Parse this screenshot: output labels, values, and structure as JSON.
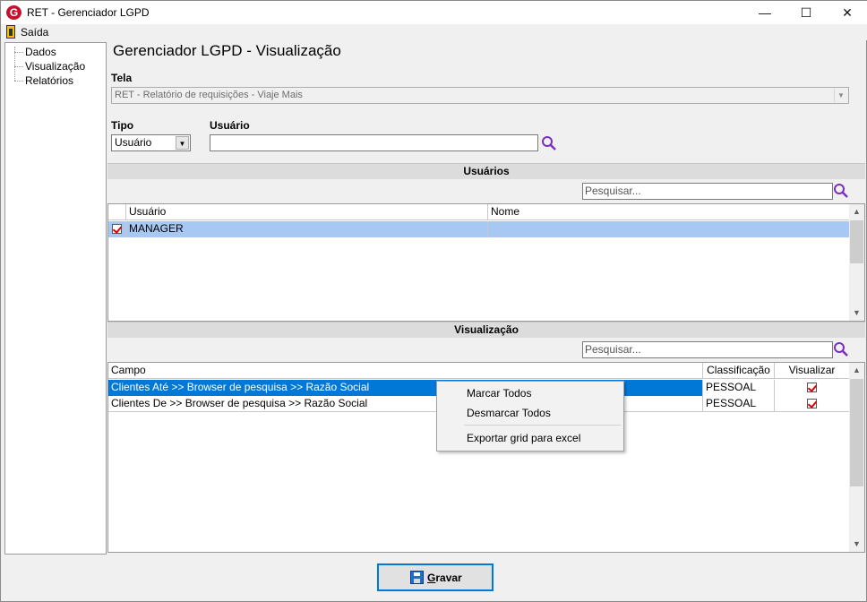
{
  "window": {
    "title": "RET - Gerenciador LGPD",
    "logo": "G",
    "minimize": "—",
    "maximize": "☐",
    "close": "✕"
  },
  "menu": {
    "exit": "Saída"
  },
  "tree": {
    "items": [
      "Dados",
      "Visualização",
      "Relatórios"
    ]
  },
  "page": {
    "title": "Gerenciador LGPD - Visualização"
  },
  "tela": {
    "label": "Tela",
    "value": "RET - Relatório de requisições - Viaje Mais"
  },
  "tipo": {
    "label": "Tipo",
    "value": "Usuário"
  },
  "usuario": {
    "label": "Usuário",
    "value": ""
  },
  "users_section": {
    "header": "Usuários",
    "search_placeholder": "Pesquisar...",
    "columns": [
      "Usuário",
      "Nome"
    ],
    "rows": [
      {
        "checked": true,
        "usuario": "MANAGER",
        "nome": ""
      }
    ]
  },
  "view_section": {
    "header": "Visualização",
    "search_placeholder": "Pesquisar...",
    "columns": [
      "Campo",
      "Classificação",
      "Visualizar"
    ],
    "rows": [
      {
        "campo": "Clientes Até >> Browser de pesquisa >> Razão Social",
        "classificacao": "PESSOAL",
        "visualizar": true
      },
      {
        "campo": "Clientes De >> Browser de pesquisa >> Razão Social",
        "classificacao": "PESSOAL",
        "visualizar": true
      }
    ]
  },
  "context_menu": {
    "items": [
      "Marcar Todos",
      "Desmarcar Todos",
      "Exportar grid para excel"
    ]
  },
  "save_button": {
    "first_letter": "G",
    "rest": "ravar"
  },
  "colors": {
    "selected_row": "#0078d7",
    "users_selected_row": "#a6c8f2",
    "section_header": "#dcdcdc",
    "search_icon": "#7b2fbe",
    "logo": "#c8102e"
  }
}
